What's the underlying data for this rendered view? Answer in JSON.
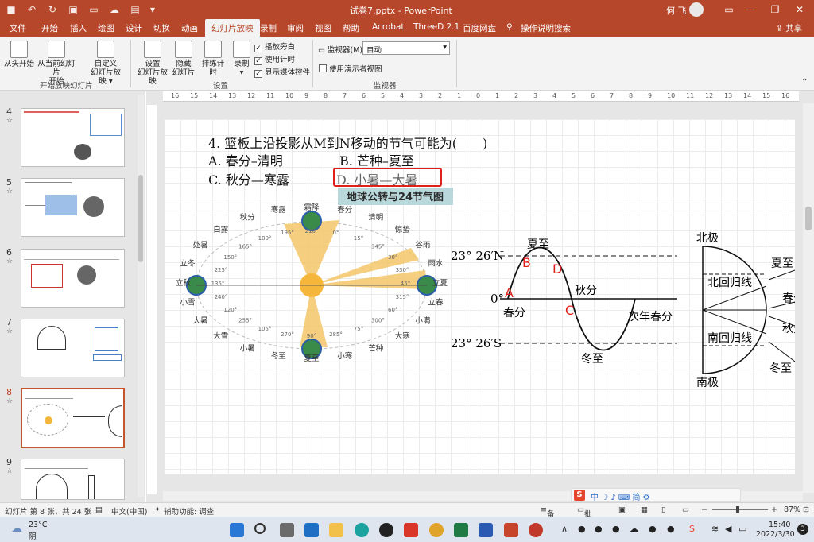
{
  "titlebar": {
    "title": "试卷7.pptx  -  PowerPoint",
    "user": "何 飞",
    "min": "—",
    "restore": "❐",
    "close": "✕"
  },
  "tabs": [
    "文件",
    "开始",
    "插入",
    "绘图",
    "设计",
    "切换",
    "动画",
    "幻灯片放映",
    "录制",
    "审阅",
    "视图",
    "帮助",
    "Acrobat",
    "ThreeD 2.1",
    "百度网盘",
    "操作说明搜索"
  ],
  "share_label": "共享",
  "ribbon": {
    "from_start": "从头开始",
    "from_current_1": "从当前幻灯片",
    "from_current_2": "开始",
    "custom_1": "自定义",
    "custom_2": "幻灯片放映 ▾",
    "group1": "开始放映幻灯片",
    "setup_1": "设置",
    "setup_2": "幻灯片放映",
    "hide_1": "隐藏",
    "hide_2": "幻灯片",
    "rehearse": "排练计时",
    "record": "录制",
    "record_arrow": "▾",
    "cb_narration": "播放旁白",
    "cb_timing": "使用计时",
    "cb_media": "显示媒体控件",
    "group2": "设置",
    "monitor_label": "监视器(M):",
    "monitor_value": "自动",
    "presenter_view": "使用演示者视图",
    "group3": "监视器"
  },
  "slides": [
    {
      "num": "4",
      "star": "☆"
    },
    {
      "num": "5",
      "star": "☆"
    },
    {
      "num": "6",
      "star": "☆"
    },
    {
      "num": "7",
      "star": "☆"
    },
    {
      "num": "8",
      "star": "☆"
    },
    {
      "num": "9",
      "star": "☆"
    }
  ],
  "ruler_ticks": [
    "16",
    "15",
    "14",
    "13",
    "12",
    "11",
    "10",
    "9",
    "8",
    "7",
    "6",
    "5",
    "4",
    "3",
    "2",
    "1",
    "0",
    "1",
    "2",
    "3",
    "4",
    "5",
    "6",
    "7",
    "8",
    "9",
    "10",
    "11",
    "12",
    "13",
    "14",
    "15",
    "16"
  ],
  "question": {
    "stem": "4. 篮板上沿投影从M到N移动的节气可能为(　　)",
    "opt_a": "A. 春分–清明",
    "opt_b": "B. 芒种–夏至",
    "opt_c": "C. 秋分—寒露",
    "opt_d": "D. 小暑—大暑"
  },
  "diagram": {
    "title": "地球公转与24节气图",
    "terms": [
      "霜降",
      "寒露",
      "秋分",
      "白露",
      "处暑",
      "立冬",
      "立秋",
      "小雪",
      "大暑",
      "大雪",
      "小暑",
      "冬至",
      "夏至",
      "小寒",
      "芒种",
      "大寒",
      "小满",
      "立春",
      "立夏",
      "雨水",
      "谷雨",
      "惊蛰",
      "清明",
      "春分"
    ],
    "degrees": [
      "210°",
      "195°",
      "180°",
      "165°",
      "150°",
      "225°",
      "135°",
      "240°",
      "120°",
      "255°",
      "105°",
      "270°",
      "90°",
      "285°",
      "75°",
      "300°",
      "60°",
      "315°",
      "45°",
      "330°",
      "30°",
      "345°",
      "15°",
      "0°"
    ]
  },
  "sine_chart": {
    "lat_n": "23° 26′N",
    "lat_0": "0°",
    "lat_s": "23° 26′S",
    "summer": "夏至",
    "spring": "春分",
    "autumn": "秋分",
    "winter": "冬至",
    "next_spring": "次年春分",
    "pt_a": "A",
    "pt_b": "B",
    "pt_c": "C",
    "pt_d": "D"
  },
  "earth_fig": {
    "north_pole": "北极",
    "south_pole": "南极",
    "tropic_n": "北回归线",
    "tropic_s": "南回归线",
    "summer": "夏至",
    "spring": "春分",
    "autumn": "秋分",
    "winter": "冬至"
  },
  "status": {
    "slide_info": "幻灯片 第 8 张，共 24 张",
    "lang": "中文(中国)",
    "access": "辅助功能: 调查",
    "notes": "备注",
    "comments": "批注",
    "zoom": "87%"
  },
  "ime_text": "中 ☽ ♪ ⌨ 简 ⚙",
  "taskbar": {
    "temp": "23°C",
    "weather": "阴",
    "time": "15:40",
    "date": "2022/3/30",
    "notif": "3"
  },
  "colors": {
    "accent": "#b7472a",
    "highlight_red": "#e0201a",
    "sun": "#f5b73b",
    "wedge": "#f3c56a"
  }
}
